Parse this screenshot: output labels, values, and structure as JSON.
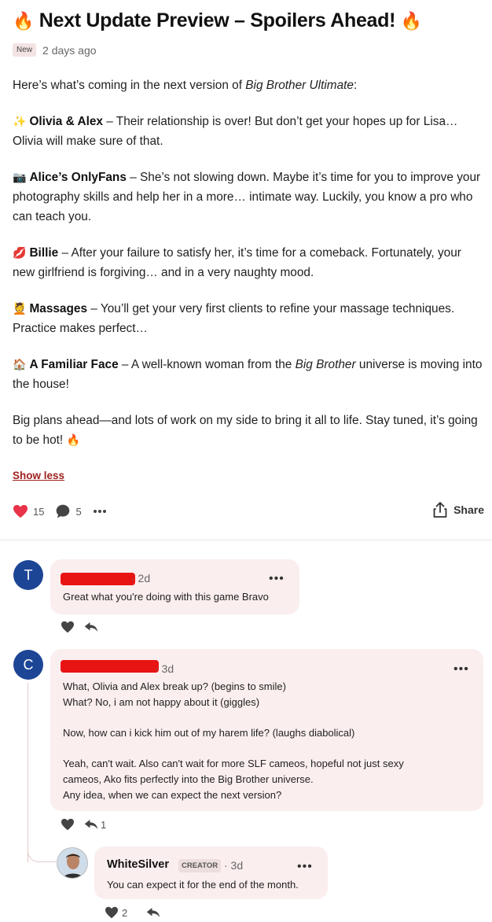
{
  "post": {
    "title_emoji": "🔥",
    "title": "Next Update Preview – Spoilers Ahead!",
    "badge": "New",
    "date": "2 days ago",
    "intro_before": "Here’s what’s coming in the next version of ",
    "intro_game": "Big Brother Ultimate",
    "intro_after": ":",
    "sections": [
      {
        "emoji": "✨",
        "heading": "Olivia & Alex",
        "text": " – Their relationship is over! But don’t get your hopes up for Lisa… Olivia will make sure of that."
      },
      {
        "emoji": "📷",
        "heading": "Alice’s OnlyFans",
        "text": " – She’s not slowing down. Maybe it’s time for you to improve your photography skills and help her in a more… intimate way. Luckily, you know a pro who can teach you."
      },
      {
        "emoji": "💋",
        "heading": "Billie",
        "text": " – After your failure to satisfy her, it’s time for a comeback. Fortunately, your new girlfriend is forgiving… and in a very naughty mood."
      },
      {
        "emoji": "💆",
        "heading": "Massages",
        "text": " – You’ll get your very first clients to refine your massage techniques. Practice makes perfect…"
      }
    ],
    "familiar": {
      "emoji": "🏠",
      "heading": "A Familiar Face",
      "text_before": " – A well-known woman from the ",
      "text_italic": "Big Brother",
      "text_after": " universe is moving into the house!"
    },
    "closing": "Big plans ahead—and lots of work on my side to bring it all to life. Stay tuned, it’s going to be hot!",
    "closing_emoji": "🔥",
    "show_less": "Show less",
    "likes": "15",
    "comments": "5",
    "share": "Share"
  },
  "comments": [
    {
      "avatar_letter": "T",
      "date": "· 2d",
      "text": "Great what you're doing with this game Bravo",
      "avatar_color": "#1d4596"
    },
    {
      "avatar_letter": "C",
      "date": "· 3d",
      "lines": [
        "What, Olivia and Alex break up? (begins to smile)",
        "What? No, i am not happy about it (giggles)",
        "",
        "Now, how can i kick him out of my harem life? (laughs diabolical)",
        "",
        "Yeah, can't wait. Also can't wait for more SLF cameos, hopeful not just sexy",
        "cameos, Ako fits perfectly into the Big Brother universe.",
        "Any idea, when we can expect the next version?"
      ],
      "reply_count": "1",
      "avatar_color": "#1d4596"
    },
    {
      "name": "WhiteSilver",
      "badge": "CREATOR",
      "date": "· 3d",
      "text": "You can expect it for the end of the month.",
      "like_count": "2"
    }
  ],
  "colors": {
    "accent": "#a12121",
    "heart": "#e8334a",
    "bubble": "#fbeeee",
    "avatar": "#1d4596"
  }
}
